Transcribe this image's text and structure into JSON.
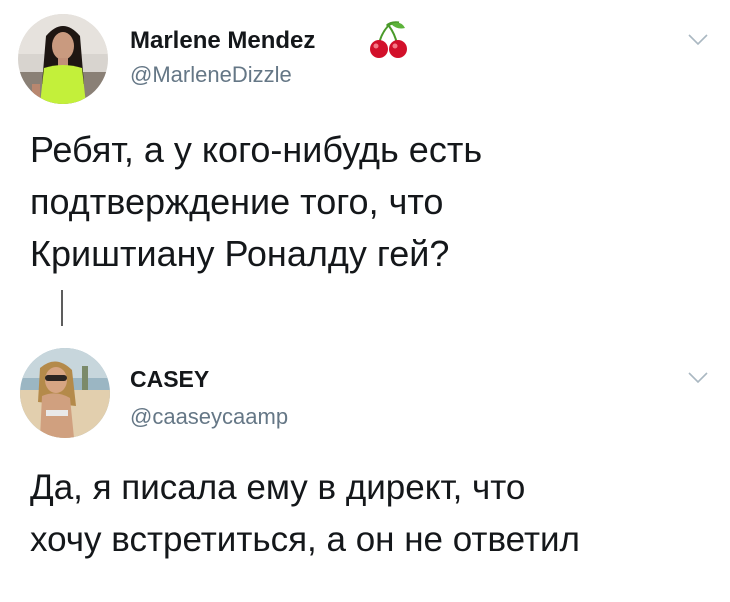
{
  "tweets": [
    {
      "display_name": "Marlene Mendez",
      "emoji_icon": "cherries-icon",
      "handle": "@MarleneDizzle",
      "text": "Ребят, а у кого-нибудь есть\nподтверждение того, что\nКриштиану Роналду гей?"
    },
    {
      "display_name": "CASEY",
      "handle": "@caaseycaamp",
      "text": "Да, я писала ему в директ, что\nхочу встретиться, а он не ответил"
    }
  ],
  "colors": {
    "text_primary": "#14171a",
    "text_secondary": "#657786",
    "chevron": "#aab8c2",
    "thread_line": "#5d5d5d"
  }
}
